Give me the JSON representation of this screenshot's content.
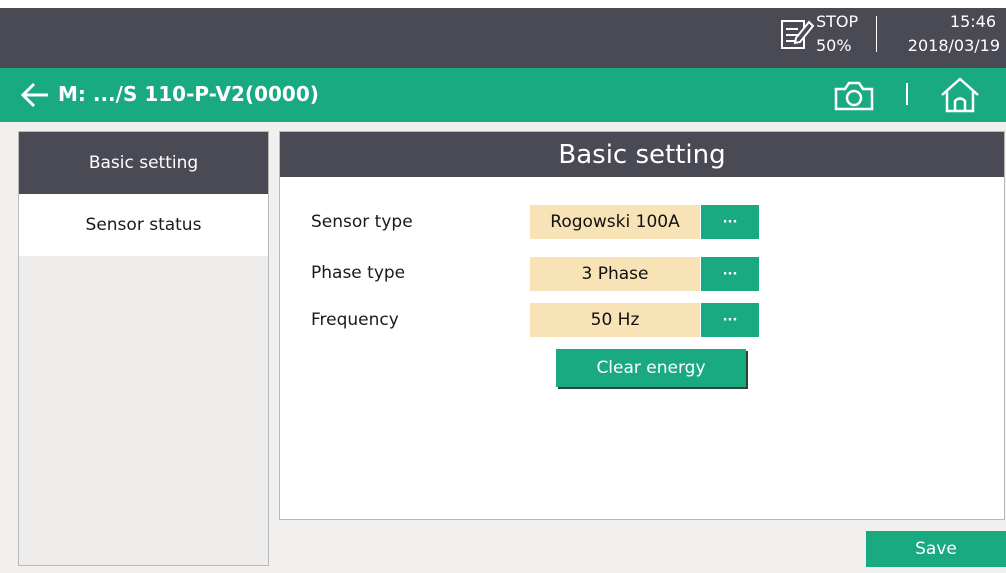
{
  "status": {
    "state": "STOP",
    "percent": "50%",
    "time": "15:46",
    "date": "2018/03/19"
  },
  "nav": {
    "title": "M: .../S 110-P-V2(0000)"
  },
  "sidebar": {
    "items": [
      {
        "label": "Basic setting"
      },
      {
        "label": "Sensor status"
      }
    ]
  },
  "panel": {
    "title": "Basic setting",
    "rows": [
      {
        "label": "Sensor type",
        "value": "Rogowski 100A",
        "button": "···"
      },
      {
        "label": "Phase type",
        "value": "3 Phase",
        "button": "···"
      },
      {
        "label": "Frequency",
        "value": "50 Hz",
        "button": "···"
      }
    ],
    "clear_label": "Clear energy"
  },
  "footer": {
    "save_label": "Save"
  },
  "colors": {
    "accent": "#1aaa82",
    "header": "#4a4a55",
    "value_bg": "#f7e3b6"
  }
}
